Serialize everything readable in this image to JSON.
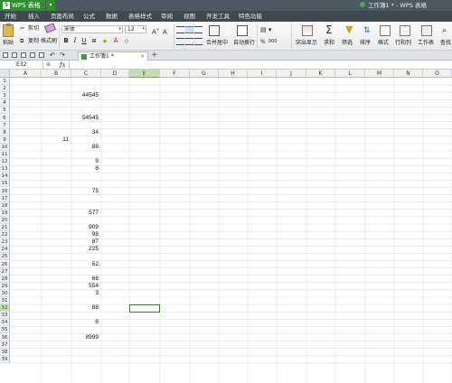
{
  "app": {
    "brand": "WPS 表格",
    "logo_letter": "S",
    "window_title": "工作簿1 * - WPS 表格"
  },
  "menu": [
    "开始",
    "插入",
    "页面布局",
    "公式",
    "数据",
    "表格样式",
    "审阅",
    "视图",
    "开发工具",
    "特色功能"
  ],
  "ribbon": {
    "paste": "粘贴",
    "cut": "剪切",
    "copy": "复制",
    "format_painter": "格式刷",
    "font": "宋体",
    "font_size": "12",
    "merge_center": "合并居中",
    "wrap_text": "自动换行",
    "percent": "%",
    "comma": "000",
    "conditional": "突出显示",
    "sum": "求和",
    "filter": "筛选",
    "sort": "排序",
    "format": "格式",
    "row_col": "行和列",
    "worksheet": "工作表",
    "find": "查找"
  },
  "doc_tab": {
    "label": "工作簿1 *",
    "new_tab": "+"
  },
  "formula_bar": {
    "name_box": "E32",
    "fx": "fx",
    "value": ""
  },
  "sheet": {
    "columns": [
      "A",
      "B",
      "C",
      "D",
      "E",
      "F",
      "G",
      "H",
      "I",
      "J",
      "K",
      "L",
      "M",
      "N",
      "O"
    ],
    "selected_column": "E",
    "selected_row": "32",
    "rows": [
      "1",
      "2",
      "3",
      "4",
      "5",
      "6",
      "7",
      "8",
      "9",
      "10",
      "11",
      "12",
      "13",
      "14",
      "15",
      "16",
      "17",
      "18",
      "19",
      "20",
      "21",
      "22",
      "23",
      "24",
      "25",
      "26",
      "27",
      "28",
      "29",
      "30",
      "31",
      "32",
      "33",
      "34",
      "35",
      "36",
      "37",
      "38",
      "39"
    ],
    "cells": [
      {
        "row": "3",
        "col": "C",
        "value": "44545",
        "align": "right"
      },
      {
        "row": "6",
        "col": "C",
        "value": "54545",
        "align": "right"
      },
      {
        "row": "8",
        "col": "C",
        "value": "34",
        "align": "right"
      },
      {
        "row": "9",
        "col": "B",
        "value": "11",
        "align": "right"
      },
      {
        "row": "10",
        "col": "C",
        "value": "88",
        "align": "right"
      },
      {
        "row": "12",
        "col": "C",
        "value": "9",
        "align": "right"
      },
      {
        "row": "13",
        "col": "C",
        "value": "8",
        "align": "right"
      },
      {
        "row": "16",
        "col": "C",
        "value": "75",
        "align": "right"
      },
      {
        "row": "19",
        "col": "C",
        "value": "577",
        "align": "right"
      },
      {
        "row": "21",
        "col": "C",
        "value": "909",
        "align": "right"
      },
      {
        "row": "22",
        "col": "C",
        "value": "98",
        "align": "right"
      },
      {
        "row": "23",
        "col": "C",
        "value": "87",
        "align": "right"
      },
      {
        "row": "24",
        "col": "C",
        "value": "225",
        "align": "right"
      },
      {
        "row": "26",
        "col": "C",
        "value": "52",
        "align": "right"
      },
      {
        "row": "28",
        "col": "C",
        "value": "66",
        "align": "right"
      },
      {
        "row": "29",
        "col": "C",
        "value": "554",
        "align": "right"
      },
      {
        "row": "30",
        "col": "C",
        "value": "3",
        "align": "right"
      },
      {
        "row": "32",
        "col": "C",
        "value": "88",
        "align": "right"
      },
      {
        "row": "34",
        "col": "C",
        "value": "8",
        "align": "right"
      },
      {
        "row": "36",
        "col": "C",
        "value": "8999",
        "align": "right"
      }
    ]
  },
  "colors": {
    "brand_green": "#2f8f2f",
    "selection_green": "#3c7a2c",
    "title_bar": "#4b5a62",
    "menu_bar": "#3f4a50"
  }
}
